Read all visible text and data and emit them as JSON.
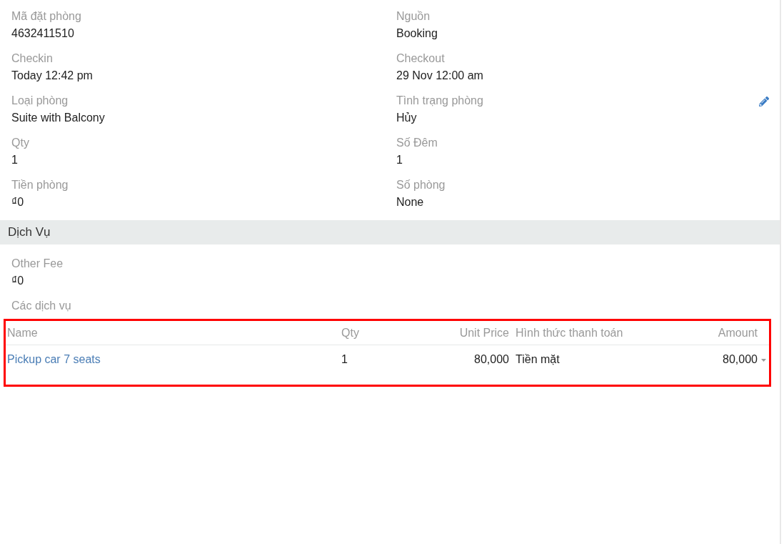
{
  "details": {
    "fields": [
      {
        "label": "Mã đặt phòng",
        "value": "4632411510",
        "editable": false
      },
      {
        "label": "Nguồn",
        "value": "Booking",
        "editable": false
      },
      {
        "label": "Checkin",
        "value": "Today 12:42 pm",
        "editable": false
      },
      {
        "label": "Checkout",
        "value": "29 Nov 12:00 am",
        "editable": false
      },
      {
        "label": "Loại phòng",
        "value": "Suite with Balcony",
        "editable": false
      },
      {
        "label": "Tình trạng phòng",
        "value": "Hủy",
        "editable": true
      },
      {
        "label": "Qty",
        "value": "1",
        "editable": false
      },
      {
        "label": "Số Đêm",
        "value": "1",
        "editable": false
      },
      {
        "label": "Tiền phòng",
        "value": "₫0",
        "editable": false
      },
      {
        "label": "Số phòng",
        "value": "None",
        "editable": false
      }
    ]
  },
  "services": {
    "title": "Dịch Vụ",
    "fields": [
      {
        "label": "Other Fee",
        "value": "₫0",
        "editable": false
      }
    ],
    "list_label": "Các dịch vụ",
    "table": {
      "columns": [
        {
          "label": "Name",
          "kind": "name"
        },
        {
          "label": "Qty",
          "kind": "count"
        },
        {
          "label": "Unit Price",
          "kind": "money"
        },
        {
          "label": "Hình thức thanh toán",
          "kind": "text"
        },
        {
          "label": "Amount",
          "kind": "money"
        }
      ],
      "rows": [
        {
          "cells": [
            "Pickup car 7 seats",
            "1",
            "80,000",
            "Tiền mặt",
            "80,000"
          ]
        }
      ]
    }
  }
}
